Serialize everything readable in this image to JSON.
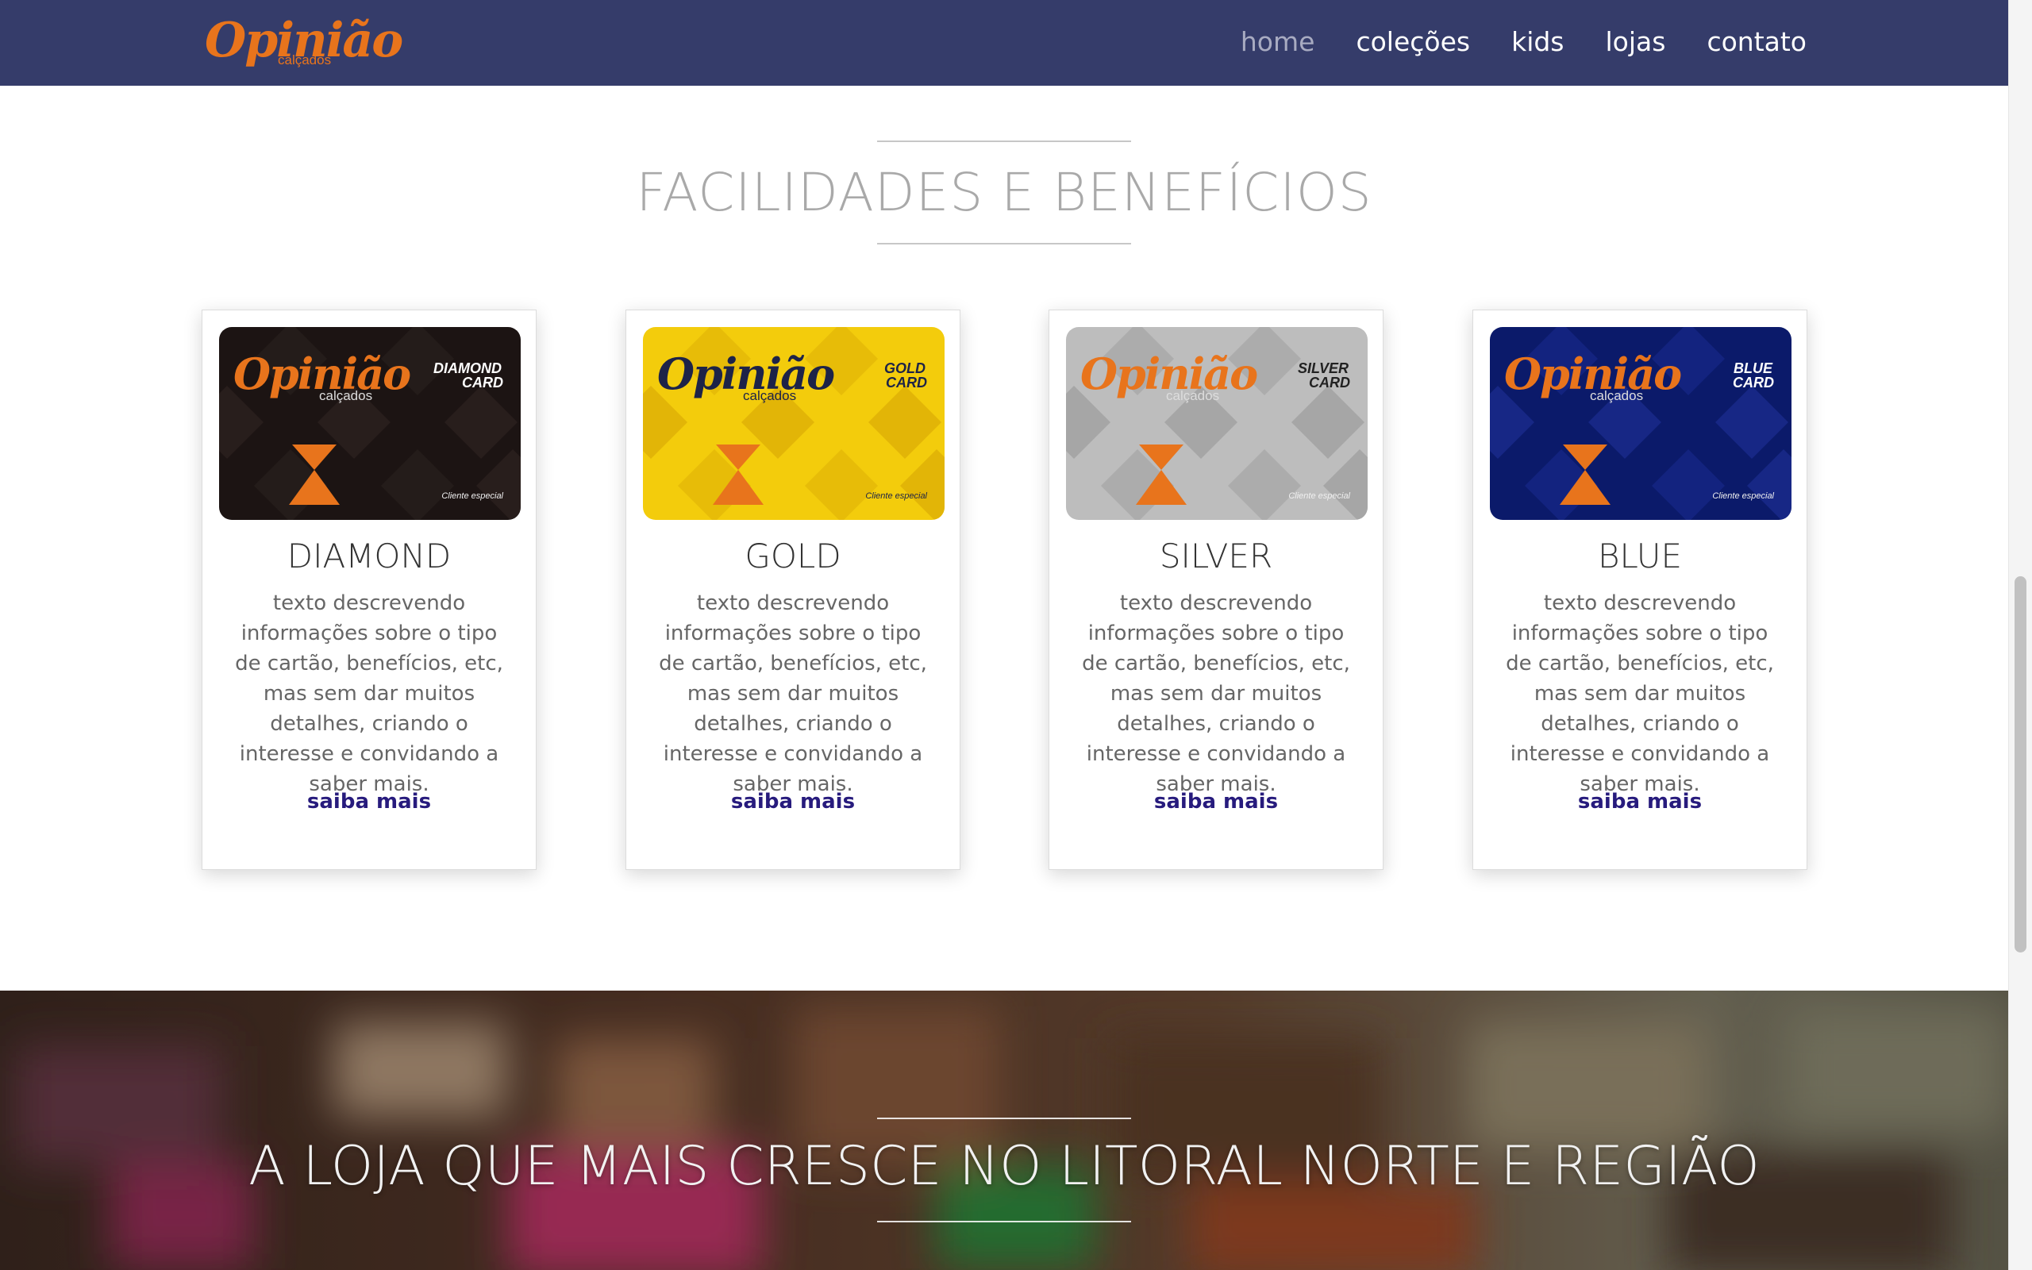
{
  "brand": {
    "logo_main": "Opinião",
    "logo_sub": "calçados",
    "color": "#e8741c"
  },
  "nav": {
    "items": [
      {
        "label": "home",
        "active": true
      },
      {
        "label": "coleções",
        "active": false
      },
      {
        "label": "kids",
        "active": false
      },
      {
        "label": "lojas",
        "active": false
      },
      {
        "label": "contato",
        "active": false
      }
    ]
  },
  "benefits": {
    "title": "FACILIDADES E BENEFÍCIOS",
    "cards": [
      {
        "name": "DIAMOND",
        "card_label_top": "DIAMOND",
        "card_label_bottom": "CARD",
        "card_footer": "Cliente especial",
        "logo_text": "Opinião",
        "logo_sub": "calçados",
        "description": "texto descrevendo informações sobre o tipo de cartão, benefícios, etc, mas sem dar muitos detalhes, criando o interesse e convidando a saber mais.",
        "link": "saiba mais",
        "colors": {
          "bg": "#1c1413",
          "tile": "#2c2220",
          "logo": "#e8741c",
          "label": "#ffffff"
        }
      },
      {
        "name": "GOLD",
        "card_label_top": "GOLD",
        "card_label_bottom": "CARD",
        "card_footer": "Cliente especial",
        "logo_text": "Opinião",
        "logo_sub": "calçados",
        "description": "texto descrevendo informações sobre o tipo de cartão, benefícios, etc, mas sem dar muitos detalhes, criando o interesse e convidando a saber mais.",
        "link": "saiba mais",
        "colors": {
          "bg": "#f3cc0c",
          "tile": "#dcae06",
          "logo": "#1d2348",
          "label": "#1d2348"
        }
      },
      {
        "name": "SILVER",
        "card_label_top": "SILVER",
        "card_label_bottom": "CARD",
        "card_footer": "Cliente especial",
        "logo_text": "Opinião",
        "logo_sub": "calçados",
        "description": "texto descrevendo informações sobre o tipo de cartão, benefícios, etc, mas sem dar muitos detalhes, criando o interesse e convidando a saber mais.",
        "link": "saiba mais",
        "colors": {
          "bg": "#bdbdbd",
          "tile": "#9f9f9f",
          "logo": "#e8741c",
          "label": "#222222"
        }
      },
      {
        "name": "BLUE",
        "card_label_top": "BLUE",
        "card_label_bottom": "CARD",
        "card_footer": "Cliente especial",
        "logo_text": "Opinião",
        "logo_sub": "calçados",
        "description": "texto descrevendo informações sobre o tipo de cartão, benefícios, etc, mas sem dar muitos detalhes, criando o interesse e convidando a saber mais.",
        "link": "saiba mais",
        "colors": {
          "bg": "#0b1a6a",
          "tile": "#1c2c8f",
          "logo": "#e8741c",
          "label": "#ffffff"
        }
      }
    ]
  },
  "hero": {
    "title": "A LOJA QUE MAIS CRESCE NO LITORAL NORTE E REGIÃO"
  }
}
